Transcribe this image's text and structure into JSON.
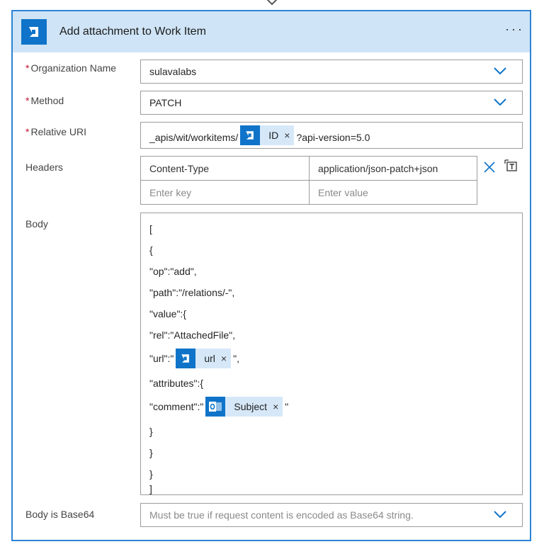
{
  "card": {
    "title": "Add attachment to Work Item",
    "more_label": "···",
    "app_icon": "azure-devops-icon",
    "accent_color": "#0f74c9",
    "header_bg": "#cfe4f6"
  },
  "fields": {
    "organization": {
      "label": "Organization Name",
      "required_mark": "*",
      "value": "sulavalabs"
    },
    "method": {
      "label": "Method",
      "required_mark": "*",
      "value": "PATCH"
    },
    "relative_uri": {
      "label": "Relative URI",
      "required_mark": "*",
      "prefix": "_apis/wit/workitems/",
      "token_label": "ID",
      "token_remove": "×",
      "suffix": "?api-version=5.0"
    },
    "headers": {
      "label": "Headers",
      "rows": [
        {
          "key": "Content-Type",
          "value": "application/json-patch+json"
        }
      ],
      "key_placeholder": "Enter key",
      "value_placeholder": "Enter value"
    },
    "body": {
      "label": "Body",
      "line1": "[",
      "line2": "{",
      "line3": "\"op\":\"add\",",
      "line4": "\"path\":\"/relations/-\",",
      "line5": "\"value\":{",
      "line6": "\"rel\":\"AttachedFile\",",
      "line7_prefix": "\"url\":\"",
      "line7_token": "url",
      "line7_suffix": "\",",
      "line8": "\"attributes\":{",
      "line9_prefix": "\"comment\":\"",
      "line9_token": "Subject",
      "line9_suffix": "\"",
      "line10": "}",
      "line11": "}",
      "line12": "}",
      "line13": "]",
      "token_remove": "×"
    },
    "body_base64": {
      "label": "Body is Base64",
      "placeholder": "Must be true if request content is encoded as Base64 string."
    }
  }
}
